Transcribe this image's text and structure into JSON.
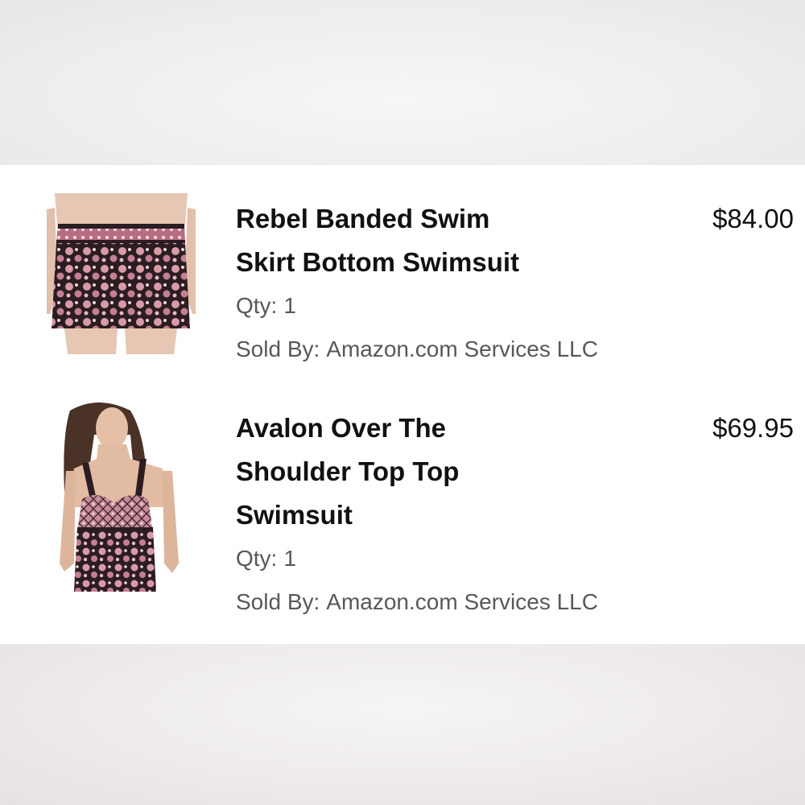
{
  "order_items": [
    {
      "title_line1": "Rebel Banded Swim",
      "title_line2": "Skirt Bottom Swimsuit",
      "price": "$84.00",
      "qty_label": "Qty:",
      "qty_value": "1",
      "sold_by_label": "Sold By:",
      "sold_by_value": "Amazon.com Services LLC",
      "image_icon": "swim-skirt-product-image"
    },
    {
      "title_line1": "Avalon Over The",
      "title_line2": "Shoulder Top Top",
      "title_line3": "Swimsuit",
      "price": "$69.95",
      "qty_label": "Qty:",
      "qty_value": "1",
      "sold_by_label": "Sold By:",
      "sold_by_value": "Amazon.com Services LLC",
      "image_icon": "swimsuit-top-product-image"
    }
  ],
  "colors": {
    "title": "#111111",
    "meta": "#565959",
    "card_bg": "#ffffff",
    "print_pink": "#c98a9a",
    "print_dark": "#2b1d22"
  }
}
